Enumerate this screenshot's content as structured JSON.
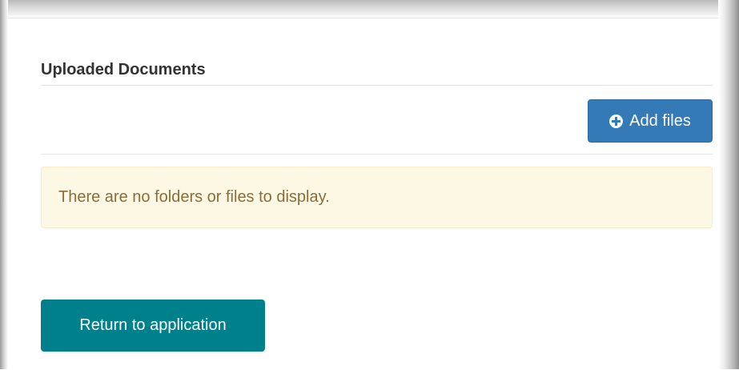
{
  "section": {
    "title": "Uploaded Documents"
  },
  "toolbar": {
    "add_files_label": "Add files",
    "add_files_icon": "plus-circle-icon"
  },
  "alert": {
    "message": "There are no folders or files to display."
  },
  "footer": {
    "return_label": "Return to application"
  },
  "colors": {
    "primary_button": "#337ab7",
    "return_button": "#00808a",
    "alert_background": "#fcf8e3",
    "alert_text": "#8a6d3b",
    "title_text": "#333333"
  }
}
